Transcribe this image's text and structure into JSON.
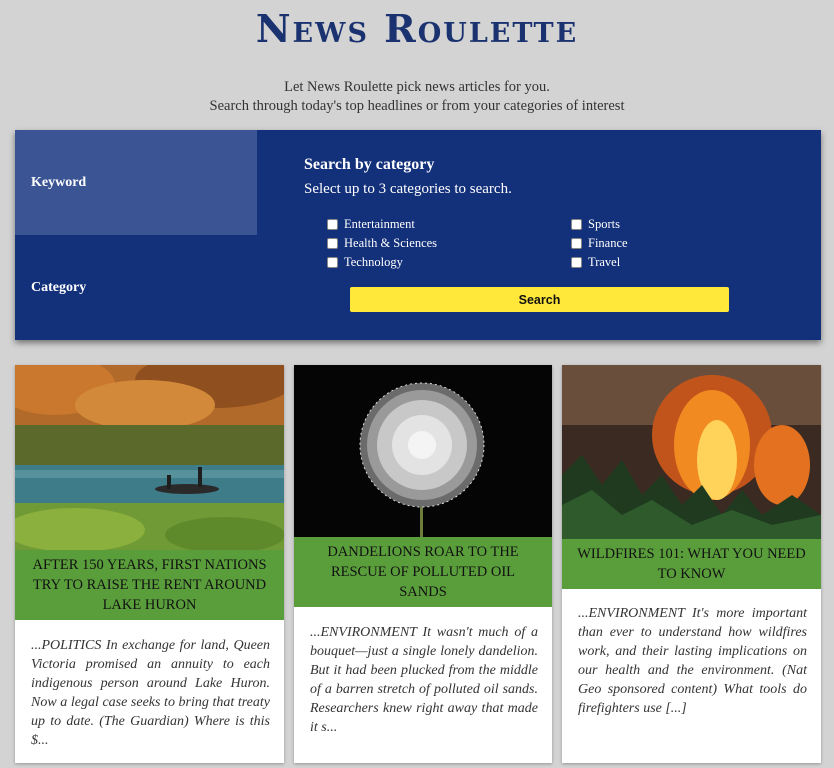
{
  "header": {
    "title": "News Roulette",
    "subtitle_line1": "Let News Roulette pick news articles for you.",
    "subtitle_line2": "Search through today's top headlines or from your categories of interest"
  },
  "tabs": {
    "keyword": "Keyword",
    "category": "Category"
  },
  "search": {
    "heading": "Search by category",
    "instructions": "Select up to 3 categories to search.",
    "categories": [
      "Entertainment",
      "Health & Sciences",
      "Technology",
      "Sports",
      "Finance",
      "Travel"
    ],
    "button_label": "Search"
  },
  "articles": [
    {
      "headline": "After 150 years, First Nations try to raise the rent around Lake Huron",
      "summary": "...POLITICS In exchange for land, Queen Victoria promised an annuity to each indigenous person around Lake Huron. Now a legal case seeks to bring that treaty up to date. (The Guardian) Where is this $..."
    },
    {
      "headline": "Dandelions roar to the rescue of polluted oil sands",
      "summary": "...ENVIRONMENT It wasn't much of a bouquet—just a single lonely dandelion. But it had been plucked from the middle of a barren stretch of polluted oil sands. Researchers knew right away that made it s..."
    },
    {
      "headline": "Wildfires 101: What you need to know",
      "summary": "...ENVIRONMENT It's more important than ever to understand how wildfires work, and their lasting implications on our health and the environment. (Nat Geo sponsored content) What tools do firefighters use [...]"
    }
  ],
  "colors": {
    "page_bg": "#d3d3d3",
    "brand_navy": "#13307a",
    "tab_active": "#3b5594",
    "headline_green": "#5a9e3c",
    "search_button": "#ffe83a"
  }
}
